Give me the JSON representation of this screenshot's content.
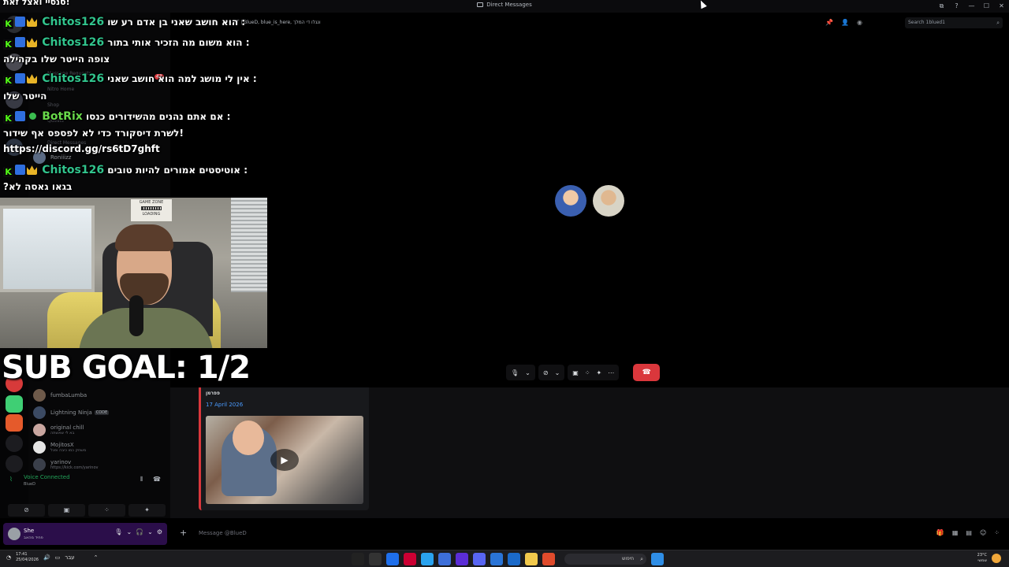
{
  "window": {
    "title": "Direct Messages",
    "controls": [
      "⧉",
      "?",
      "—",
      "☐",
      "✕"
    ]
  },
  "sidebar": {
    "dimmed_rows": [
      "Message Requests",
      "Nitro Home",
      "Shop",
      "Quests",
      "Direct Messages"
    ],
    "message_requests_count": "43",
    "dm_items": [
      {
        "name": "Roniiizz",
        "sub": ""
      },
      {
        "name": "fumbaLumba",
        "sub": ""
      },
      {
        "name": "Lightning Ninja",
        "sub": "",
        "tag": "CODE"
      },
      {
        "name": "original chill",
        "sub": "בא לי שאשתה"
      },
      {
        "name": "MojitosX",
        "sub": "משחק כמו כיבה ופגל"
      },
      {
        "name": "yarinov",
        "sub": "https://kick.com/yarinov"
      }
    ],
    "voice": {
      "status": "Voice Connected",
      "channel": "BlueD"
    },
    "voice_buttons": [
      "⊘",
      "▣",
      "⁘",
      "✦"
    ],
    "user": {
      "name": "She",
      "status": "פחיד מהאב",
      "controls": [
        "🎙",
        "⌄",
        "🎧",
        "⌄",
        "⚙"
      ]
    }
  },
  "header": {
    "title": "YT | BlueD, blue_is_here, ונגלו די המלך",
    "icons": [
      "pin-icon",
      "add-friend-icon",
      "profile-icon"
    ],
    "search_placeholder": "Search 1blued1"
  },
  "call": {
    "controls": [
      "🎙",
      "⌄",
      "⊘",
      "⌄",
      "▣",
      "⁘",
      "✦",
      "⋯"
    ],
    "hangup": "☎"
  },
  "message": {
    "author": "פפרמן",
    "date": "17 April 2026",
    "play_icon": "▶"
  },
  "composer": {
    "placeholder": "Message @BlueD",
    "plus": "+",
    "tools": [
      "🎁",
      "▦",
      "▤",
      "☺",
      "⁘"
    ]
  },
  "overlay": {
    "top_line": "סנסיי ואצל זאת!",
    "chat": [
      {
        "user": "Chitos126",
        "msg": "הוא חושב שאני בן אדם רע שו :",
        "cont": ""
      },
      {
        "user": "Chitos126",
        "msg": "הוא משום מה הזכיר אותי בתור :",
        "cont": "צופה הייטר שלו בקהילה"
      },
      {
        "user": "Chitos126",
        "msg": "אין לי מושג למה הוא חושב שאני :",
        "cont": "הייטר שלו"
      },
      {
        "user": "BotRix",
        "msg": "אם אתם נהנים מהשידורים כנסו :",
        "cont": "לשרת דיסקורד כדי לא לפספס אף שידור!",
        "cont2": "https://discord.gg/rs6tD7ghft"
      },
      {
        "user": "Chitos126",
        "msg": "אוטיסטים אמורים להיות טובים :",
        "cont": "?בגאו גאסה לא"
      }
    ],
    "webcam_poster": "GAME ZONE",
    "webcam_poster_sub": "LOADING",
    "sub_goal": "SUB GOAL: 1/2"
  },
  "taskbar": {
    "time": "17:41",
    "date": "25/04/2026",
    "lang": "עבר",
    "search_placeholder": "חיפוש",
    "weather_temp": "23°C",
    "weather_desc": "שמשי",
    "apps": [
      "#222",
      "#333",
      "#1f6feb",
      "#c03",
      "#2aa3ef",
      "#3d6fd9",
      "#5b2dd6",
      "#5865f2",
      "#2a74d6",
      "#1b6ac9",
      "#f2c94c",
      "#e04b2c"
    ]
  },
  "colors": {
    "accent_red": "#da373c",
    "voice_green": "#23a55a",
    "chat_user": "#31c48d",
    "link_blue": "#4a9bff"
  }
}
